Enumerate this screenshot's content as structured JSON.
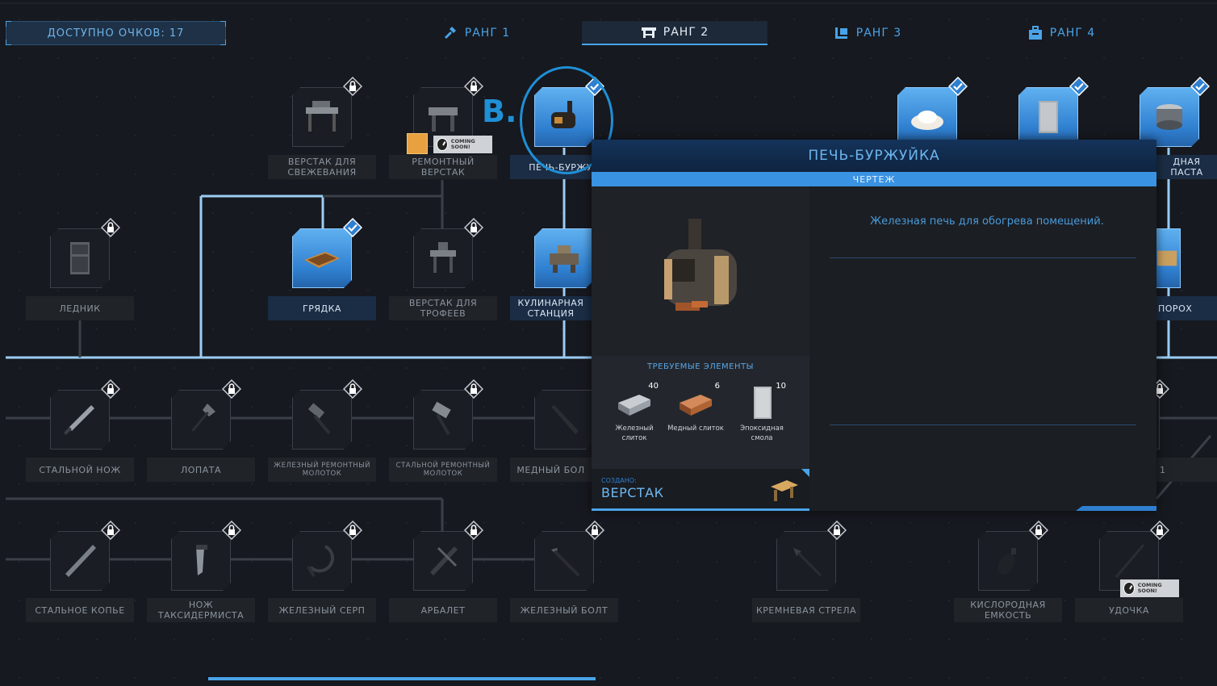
{
  "header": {
    "points_label": "ДОСТУПНО ОЧКОВ: 17",
    "tabs": [
      {
        "label": "РАНГ 1",
        "icon": "hammer-icon"
      },
      {
        "label": "РАНГ 2",
        "icon": "workbench-icon"
      },
      {
        "label": "РАНГ 3",
        "icon": "cart-icon"
      },
      {
        "label": "РАНГ 4",
        "icon": "toolbox-icon"
      }
    ],
    "active_tab": "РАНГ 2"
  },
  "annotation": {
    "letter": "B."
  },
  "coming_soon_text": "COMING SOON!",
  "items": {
    "fresh_bench": "ВЕРСТАК ДЛЯ СВЕЖЕВАНИЯ",
    "repair_bench": "РЕМОНТНЫЙ ВЕРСТАК",
    "stove": "ПЕЧЬ-БУРЖУЙ",
    "paste": "ДНАЯ ПАСТА",
    "icebox": "ЛЕДНИК",
    "garden": "ГРЯДКА",
    "trophy_bench": "ВЕРСТАК ДЛЯ ТРОФЕЕВ",
    "cooking": "КУЛИНАРНАЯ СТАНЦИЯ",
    "gunpowder": "ПОРОХ",
    "steel_knife": "СТАЛЬНОЙ НОЖ",
    "shovel": "ЛОПАТА",
    "iron_hammer": "ЖЕЛЕЗНЫЙ РЕМОНТНЫЙ МОЛОТОК",
    "steel_hammer": "СТАЛЬНОЙ РЕМОНТНЫЙ МОЛОТОК",
    "copper_bolt": "МЕДНЫЙ БОЛ",
    "row2_right": "1",
    "steel_spear": "СТАЛЬНОЕ КОПЬЕ",
    "taxidermy_knife": "НОЖ ТАКСИДЕРМИСТА",
    "iron_sickle": "ЖЕЛЕЗНЫЙ СЕРП",
    "crossbow": "АРБАЛЕТ",
    "iron_bolt": "ЖЕЛЕЗНЫЙ БОЛТ",
    "flint_arrow": "КРЕМНЕВАЯ СТРЕЛА",
    "oxygen_tank": "КИСЛОРОДНАЯ ЕМКОСТЬ",
    "fishing_rod": "УДОЧКА"
  },
  "panel": {
    "title": "ПЕЧЬ-БУРЖУЙКА",
    "subtitle": "ЧЕРТЕЖ",
    "description": "Железная печь для обогрева помещений.",
    "required_title": "ТРЕБУЕМЫЕ ЭЛЕМЕНТЫ",
    "required": [
      {
        "qty": "40",
        "name": "Железный слиток"
      },
      {
        "qty": "6",
        "name": "Медный слиток"
      },
      {
        "qty": "10",
        "name": "Эпоксидная смола"
      }
    ],
    "made_at_label": "СОЗДАНО:",
    "made_at_value": "ВЕРСТАК"
  },
  "colors": {
    "accent": "#4aa3e8",
    "background": "#16191f",
    "unlocked_tile": "#3a8ee0"
  }
}
